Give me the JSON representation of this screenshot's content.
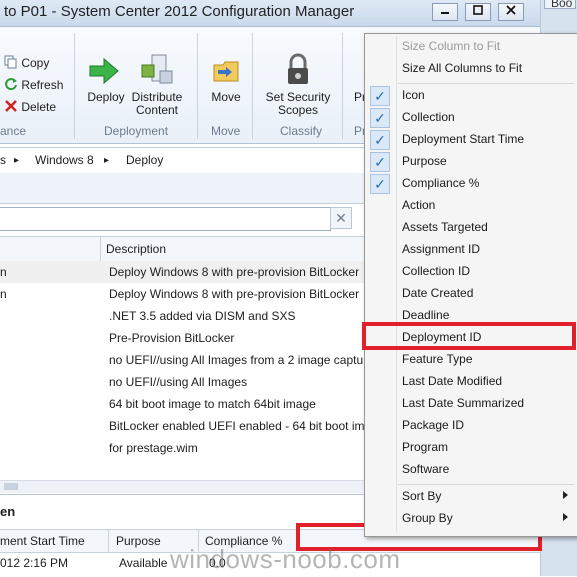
{
  "window": {
    "title": "to P01 - System Center 2012 Configuration Manager",
    "right_tab_label": "Boo",
    "help_icon": "help-icon"
  },
  "ribbon": {
    "copy_label": "Copy",
    "refresh_label": "Refresh",
    "delete_label": "Delete",
    "ance_group": "ance",
    "deploy_label": "Deploy",
    "distribute_line1": "Distribute",
    "distribute_line2": "Content",
    "deployment_group": "Deployment",
    "move_label": "Move",
    "move_group": "Move",
    "security_line1": "Set Security",
    "security_line2": "Scopes",
    "classify_group": "Classify",
    "pr_label": "Pr",
    "pr_group": "Pr"
  },
  "breadcrumb": {
    "sep1": "s",
    "item1": "Windows 8",
    "item2": "Deploy",
    "chevron": "▸"
  },
  "search": {
    "value": "",
    "clear_glyph": "✕"
  },
  "list": {
    "columns": {
      "first_fragment": "",
      "description": "Description"
    },
    "rows": [
      {
        "a": "n",
        "description": "Deploy Windows 8 with pre-provision BitLocker"
      },
      {
        "a": "n",
        "description": "Deploy Windows 8 with pre-provision BitLocker"
      },
      {
        "a": "",
        "description": ".NET 3.5 added via DISM and SXS"
      },
      {
        "a": "",
        "description": "Pre-Provision BitLocker"
      },
      {
        "a": "",
        "description": "no UEFI//using All Images from a 2 image captu"
      },
      {
        "a": "",
        "description": "no UEFI//using All Images"
      },
      {
        "a": "",
        "description": "64 bit boot image to match 64bit image"
      },
      {
        "a": "",
        "description": "BitLocker enabled UEFI enabled - 64 bit boot ima"
      },
      {
        "a": "",
        "description": "for prestage.wim"
      }
    ]
  },
  "bottom": {
    "section_title": "en",
    "columns": {
      "start": "ment Start Time",
      "purpose": "Purpose",
      "compliance": "Compliance %"
    },
    "row": {
      "start": "012 2:16 PM",
      "purpose": "Available",
      "compliance": "0.0"
    }
  },
  "context_menu": {
    "size_column": "Size Column to Fit",
    "size_all": "Size All Columns to Fit",
    "checked_items": [
      "Icon",
      "Collection",
      "Deployment Start Time",
      "Purpose",
      "Compliance %"
    ],
    "unchecked_items": [
      "Action",
      "Assets Targeted",
      "Assignment ID",
      "Collection ID",
      "Date Created",
      "Deadline",
      "Deployment ID",
      "Feature Type",
      "Last Date Modified",
      "Last Date Summarized",
      "Package ID",
      "Program",
      "Software"
    ],
    "sort_by": "Sort By",
    "group_by": "Group By",
    "check_glyph": "✓"
  },
  "watermark": "windows-noob.com",
  "colors": {
    "highlight_red": "#e0202a",
    "ribbon_bg": "#e9f0f8",
    "check_blue": "#2a6db5"
  }
}
